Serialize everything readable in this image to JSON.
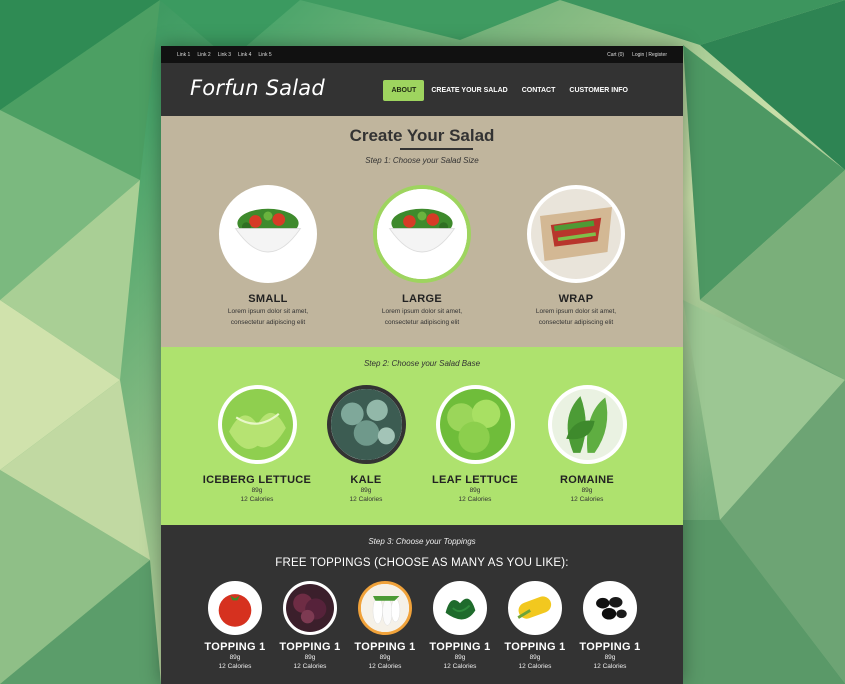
{
  "topbar": {
    "links": [
      "Link 1",
      "Link 2",
      "Link 3",
      "Link 4",
      "Link 5"
    ],
    "cart": "Cart (0)",
    "login": "Login | Register"
  },
  "header": {
    "logo": "Forfun Salad",
    "nav": [
      "ABOUT",
      "CREATE YOUR SALAD",
      "CONTACT",
      "CUSTOMER INFO"
    ],
    "active_nav": "ABOUT"
  },
  "step1": {
    "title": "Create Your Salad",
    "label": "Step 1: Choose your Salad Size",
    "sizes": [
      {
        "name": "SMALL",
        "desc1": "Lorem ipsum dolor sit amet,",
        "desc2": "consectetur adipiscing elit",
        "icon": "salad-bowl-icon"
      },
      {
        "name": "LARGE",
        "desc1": "Lorem ipsum dolor sit amet,",
        "desc2": "consectetur adipiscing elit",
        "icon": "salad-bowl-icon",
        "selected": true
      },
      {
        "name": "WRAP",
        "desc1": "Lorem ipsum dolor sit amet,",
        "desc2": "consectetur adipiscing elit",
        "icon": "wrap-icon"
      }
    ]
  },
  "step2": {
    "label": "Step 2: Choose your Salad Base",
    "bases": [
      {
        "name": "ICEBERG LETTUCE",
        "weight": "89g",
        "calories": "12 Calories",
        "icon": "iceberg-lettuce-icon"
      },
      {
        "name": "KALE",
        "weight": "89g",
        "calories": "12 Calories",
        "icon": "kale-icon",
        "selected": true
      },
      {
        "name": "LEAF LETTUCE",
        "weight": "89g",
        "calories": "12 Calories",
        "icon": "leaf-lettuce-icon"
      },
      {
        "name": "ROMAINE",
        "weight": "89g",
        "calories": "12 Calories",
        "icon": "romaine-icon"
      }
    ]
  },
  "step3": {
    "label": "Step 3: Choose your Toppings",
    "free_heading": "FREE TOPPINGS (CHOOSE AS MANY AS YOU LIKE):",
    "toppings": [
      {
        "name": "TOPPING 1",
        "weight": "89g",
        "calories": "12 Calories",
        "icon": "tomato-icon"
      },
      {
        "name": "TOPPING 1",
        "weight": "89g",
        "calories": "12 Calories",
        "icon": "red-lettuce-icon"
      },
      {
        "name": "TOPPING 1",
        "weight": "89g",
        "calories": "12 Calories",
        "icon": "radish-icon",
        "selected": true
      },
      {
        "name": "TOPPING 1",
        "weight": "89g",
        "calories": "12 Calories",
        "icon": "spinach-icon"
      },
      {
        "name": "TOPPING 1",
        "weight": "89g",
        "calories": "12 Calories",
        "icon": "corn-icon"
      },
      {
        "name": "TOPPING 1",
        "weight": "89g",
        "calories": "12 Calories",
        "icon": "olives-icon"
      }
    ]
  },
  "colors": {
    "accent_green": "#9ed45f",
    "section_tan": "#c0b59d",
    "section_green": "#aee26e",
    "dark": "#333333",
    "selected_orange": "#f0a23a"
  }
}
